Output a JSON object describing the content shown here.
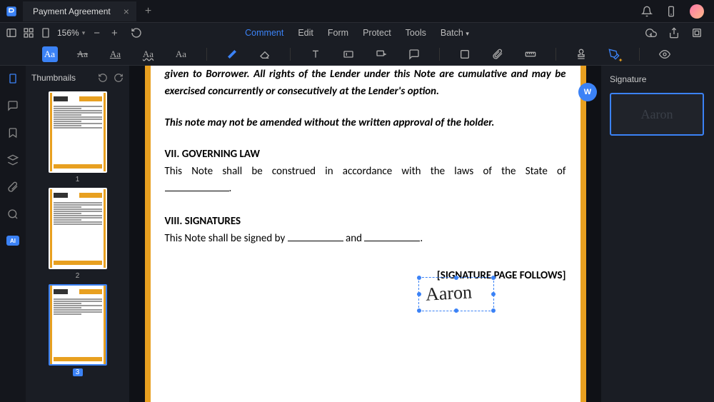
{
  "titlebar": {
    "doc_title": "Payment Agreement"
  },
  "toprow": {
    "zoom": "156%",
    "menu": {
      "comment": "Comment",
      "edit": "Edit",
      "form": "Form",
      "protect": "Protect",
      "tools": "Tools",
      "batch": "Batch"
    }
  },
  "thumbs": {
    "title": "Thumbnails",
    "pages": [
      "1",
      "2",
      "3"
    ]
  },
  "doc": {
    "p1": "given to Borrower. All rights of the Lender under this Note are cumulative and may be exercised concurrently or consecutively at the Lender's option.",
    "p2": "This note may not be amended without the written approval of the holder.",
    "h7": "VII. GOVERNING LAW",
    "p3a": "This Note shall be construed in accordance with the laws of the State of ",
    "h8": "VIII. SIGNATURES",
    "p4a": "This Note shall be signed by ",
    "p4b": " and ",
    "sigfollows": "[SIGNATURE PAGE FOLLOWS]",
    "signature_text": "Aaron"
  },
  "rightpanel": {
    "title": "Signature"
  },
  "rail": {
    "ai": "AI"
  },
  "float": {
    "w": "W"
  }
}
